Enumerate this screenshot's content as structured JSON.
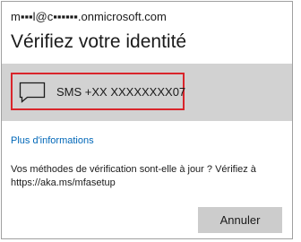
{
  "account": {
    "email": "m▪▪▪l@c▪▪▪▪▪▪.onmicrosoft.com"
  },
  "title": "Vérifiez votre identité",
  "method": {
    "icon": "message-bubble-icon",
    "label": "SMS +XX XXXXXXXX07",
    "highlight_color": "#d9252b"
  },
  "more_info_link": "Plus d'informations",
  "notice": {
    "line1": "Vos méthodes de vérification sont-elle à jour ? Vérifiez à",
    "line2": "https://aka.ms/mfasetup"
  },
  "buttons": {
    "cancel": "Annuler"
  },
  "colors": {
    "link": "#0067b8",
    "band": "#d2d2d2",
    "button": "#cccccc"
  }
}
